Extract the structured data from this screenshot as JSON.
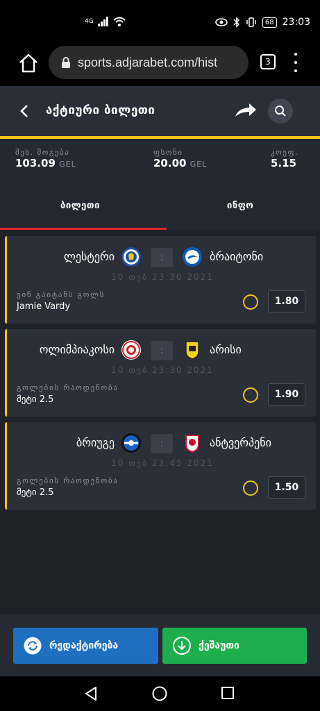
{
  "status_bar": {
    "network": "4G",
    "battery": "68",
    "time": "23:03"
  },
  "browser": {
    "url": "sports.adjarabet.com/hist",
    "tab_count": "3"
  },
  "header": {
    "title": "აქტიური ბილეთი"
  },
  "summary": {
    "win_label": "შეს. მოგება",
    "win_value": "103.09",
    "win_currency": "GEL",
    "stake_label": "ფსონი",
    "stake_value": "20.00",
    "stake_currency": "GEL",
    "odds_label": "კოეფ.",
    "odds_value": "5.15"
  },
  "tabs": {
    "ticket": "ბილეთი",
    "info": "ინფო"
  },
  "matches": [
    {
      "home": "ლესტერი",
      "away": "ბრაიტონი",
      "score_sep": ":",
      "date": "10 თებ 23:30 2021",
      "market": "ვინ გაიტანს გოლს",
      "pick": "Jamie Vardy",
      "odd": "1.80"
    },
    {
      "home": "ოლიმპიაკოსი",
      "away": "არისი",
      "score_sep": ":",
      "date": "10 თებ 23:30 2021",
      "market": "გოლების რაოდენობა",
      "pick": "მეტი 2.5",
      "odd": "1.90"
    },
    {
      "home": "ბრიუგე",
      "away": "ანტვერპენი",
      "score_sep": ":",
      "date": "10 თებ 23:45 2021",
      "market": "გოლების რაოდენობა",
      "pick": "მეტი 2.5",
      "odd": "1.50"
    }
  ],
  "actions": {
    "edit": "რედაქტირება",
    "cashout": "ქეშაუთი"
  },
  "colors": {
    "accent_yellow": "#f3c41a",
    "tab_red": "#e02430",
    "edit_blue": "#1f6fc0",
    "cashout_green": "#1fae4d"
  }
}
